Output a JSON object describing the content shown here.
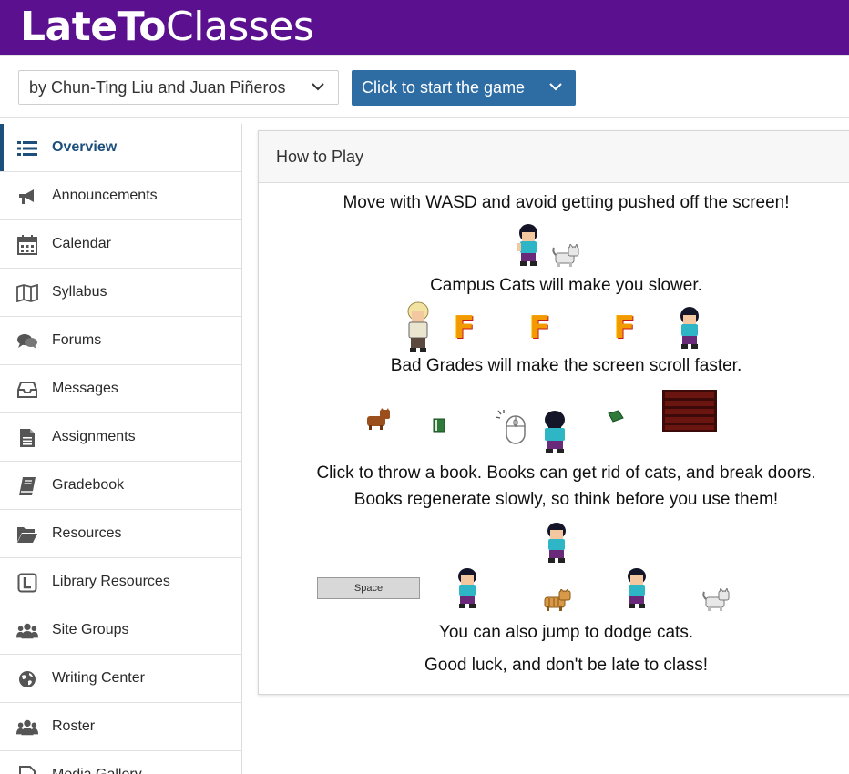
{
  "header": {
    "brand_bold": "LateTo",
    "brand_light": "Classes"
  },
  "toolbar": {
    "site_select_value": "by Chun-Ting Liu and Juan Piñeros",
    "start_button_label": "Click to start the game"
  },
  "sidebar": {
    "items": [
      {
        "label": "Overview",
        "icon": "list-icon",
        "active": true
      },
      {
        "label": "Announcements",
        "icon": "megaphone-icon"
      },
      {
        "label": "Calendar",
        "icon": "calendar-icon"
      },
      {
        "label": "Syllabus",
        "icon": "map-icon"
      },
      {
        "label": "Forums",
        "icon": "chat-bubbles-icon"
      },
      {
        "label": "Messages",
        "icon": "inbox-icon"
      },
      {
        "label": "Assignments",
        "icon": "document-icon"
      },
      {
        "label": "Gradebook",
        "icon": "book-icon"
      },
      {
        "label": "Resources",
        "icon": "folder-open-icon"
      },
      {
        "label": "Library Resources",
        "icon": "library-l-icon"
      },
      {
        "label": "Site Groups",
        "icon": "users-icon"
      },
      {
        "label": "Writing Center",
        "icon": "globe-icon"
      },
      {
        "label": "Roster",
        "icon": "users-icon"
      },
      {
        "label": "Media Gallery",
        "icon": "media-icon"
      }
    ]
  },
  "panel": {
    "title": "How to Play",
    "lines": {
      "move": "Move with WASD and avoid getting pushed off the screen!",
      "cats": "Campus Cats will make you slower.",
      "grades": "Bad Grades will make the screen scroll faster.",
      "throw": "Click to throw a book. Books can get rid of cats, and break doors.",
      "regen": "Books regenerate slowly, so think before you use them!",
      "jump": "You can also jump to dodge cats.",
      "luck": "Good luck, and don't be late to class!"
    },
    "space_key_label": "Space",
    "grade_letter": "F"
  },
  "colors": {
    "header_bg": "#5a108f",
    "button_bg": "#2e6da4",
    "active_nav": "#1d4f7c"
  }
}
